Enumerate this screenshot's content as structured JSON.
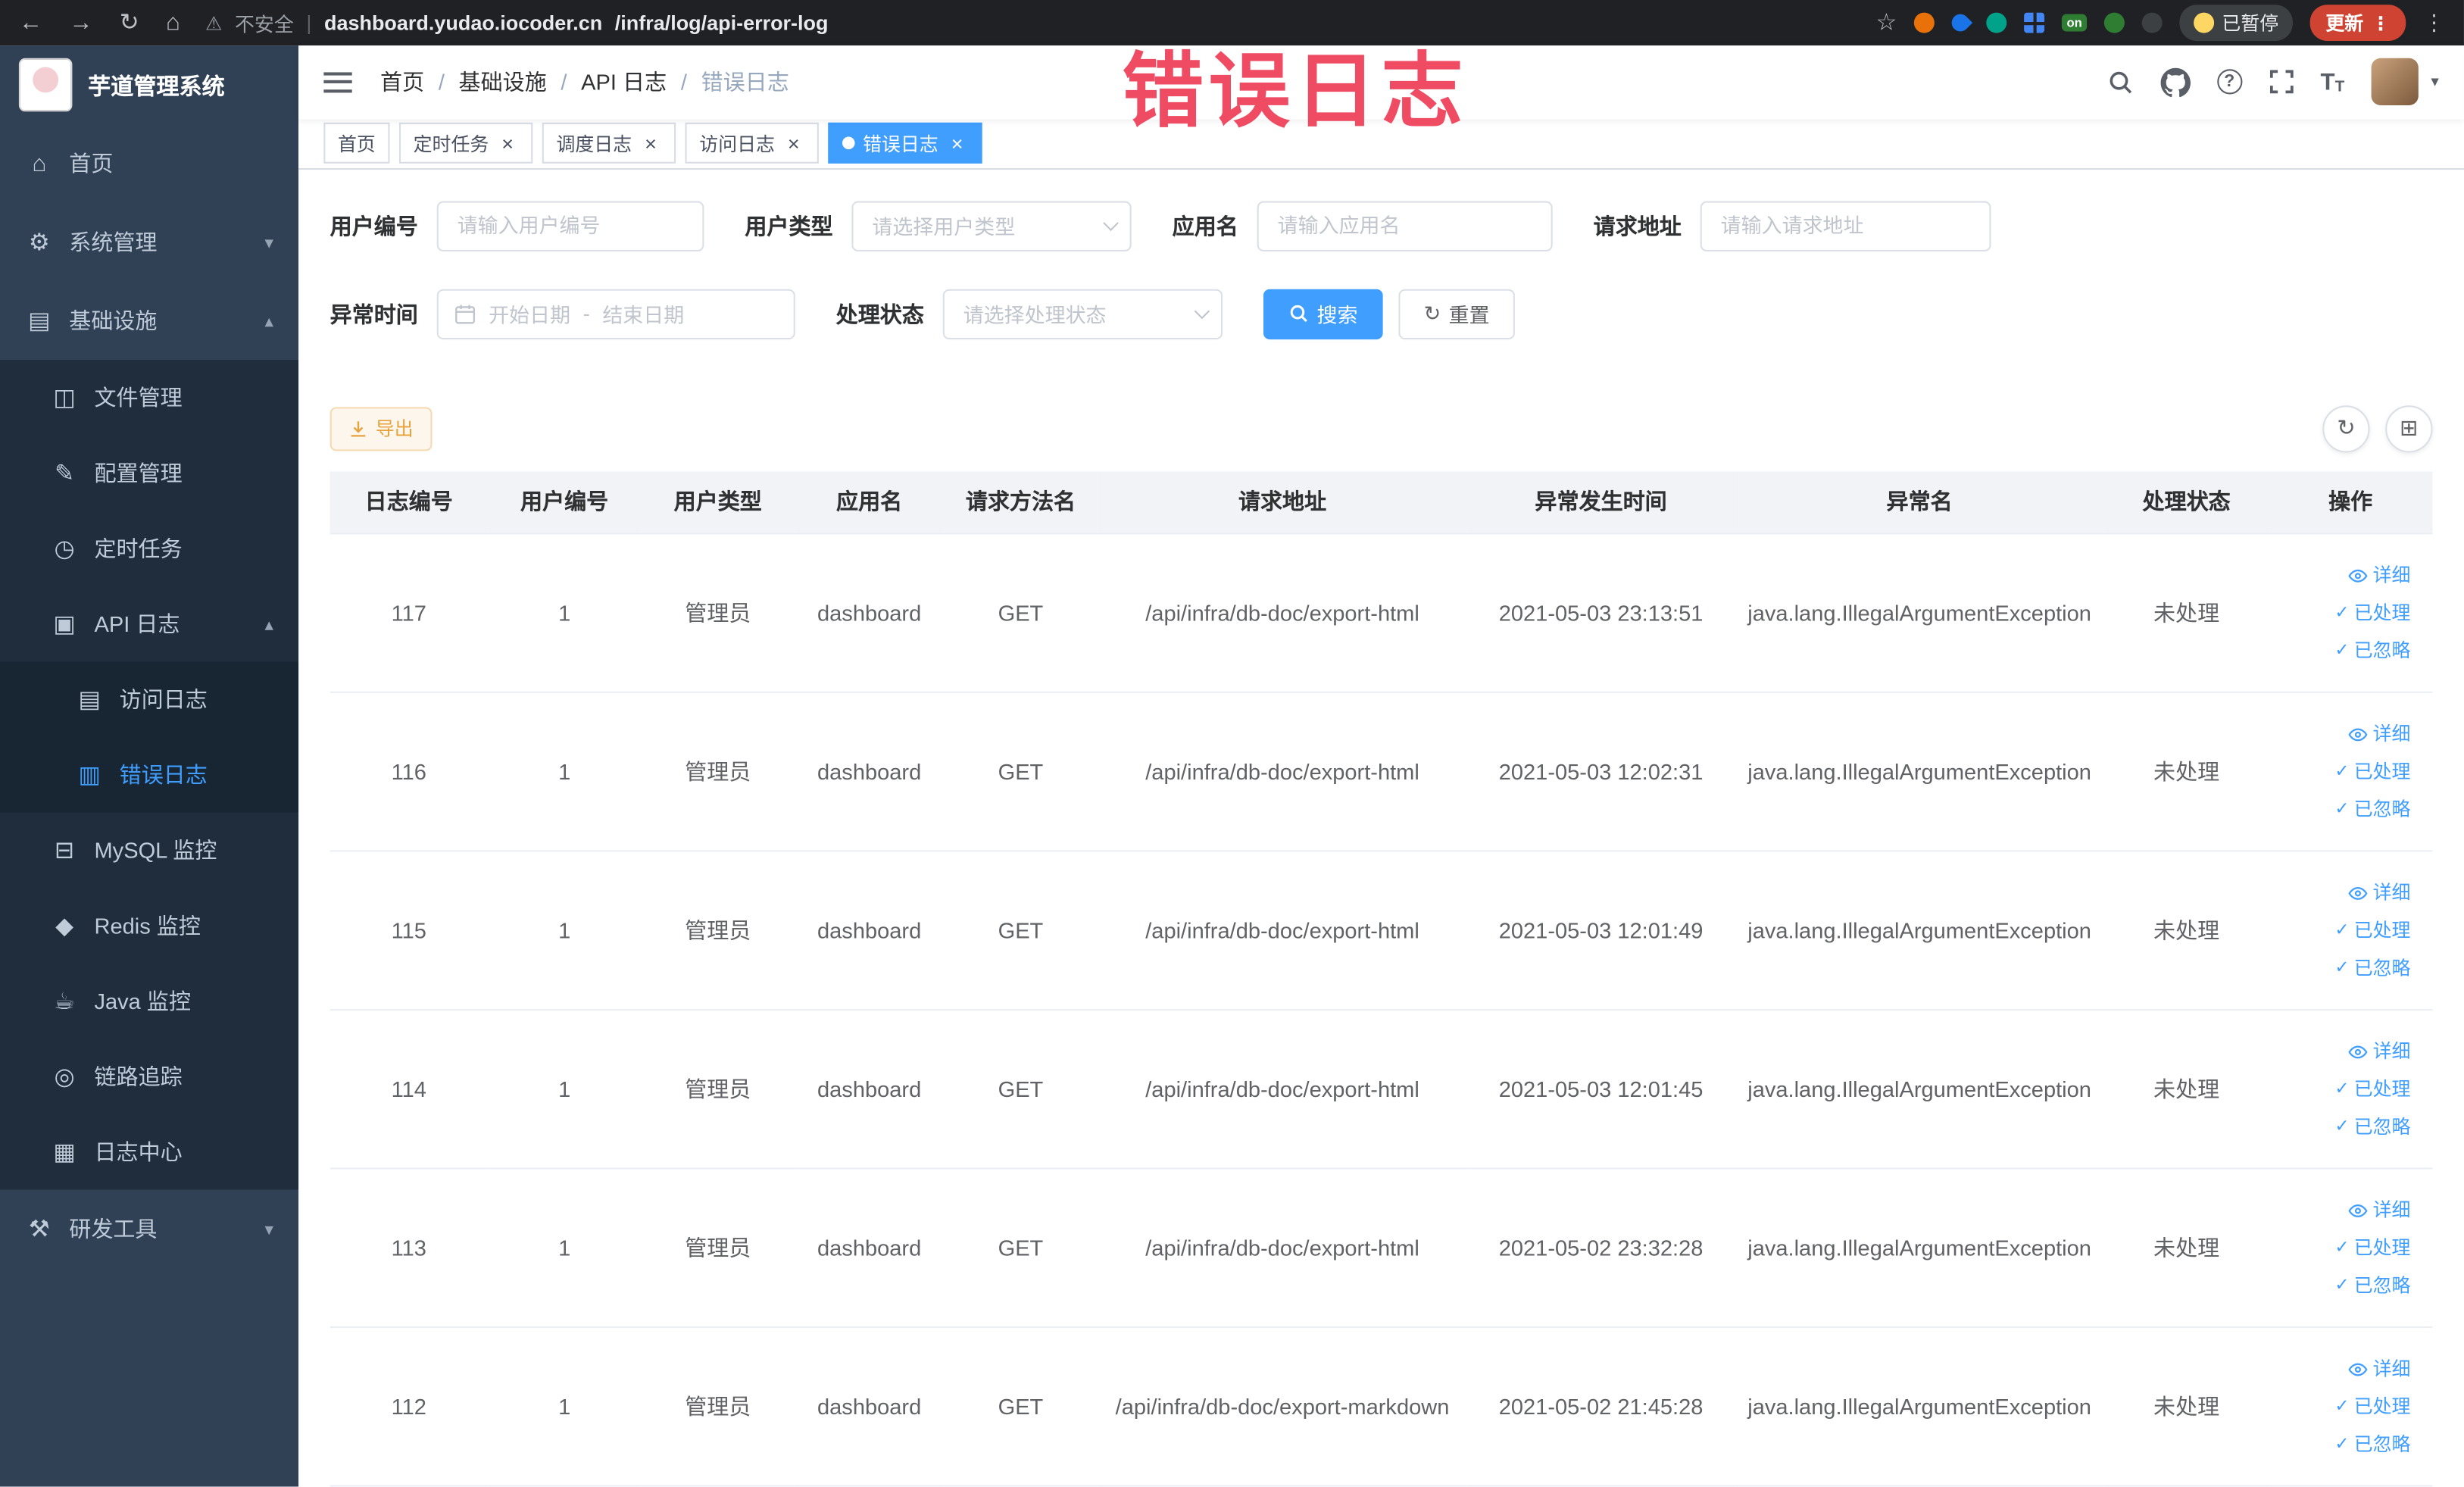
{
  "browser": {
    "security_label": "不安全",
    "url_domain": "dashboard.yudao.iocoder.cn",
    "url_path": "/infra/log/api-error-log",
    "paused_badge": "已暂停",
    "update_button": "更新"
  },
  "watermark": "错误日志",
  "icons": {
    "back": "←",
    "forward": "→",
    "reload": "↻",
    "home": "⌂",
    "warning": "⚠",
    "star": "☆",
    "more": "⋮",
    "close": "×",
    "caret": "▾",
    "chevron_down": "▾",
    "chevron_up": "▴",
    "refresh": "↻",
    "columns": "⊞",
    "check": "✓",
    "reset": "↻",
    "ext_on": "on",
    "font_large": "T",
    "font_small": "T"
  },
  "sidebar": {
    "title": "芋道管理系统",
    "items": [
      {
        "label": "首页",
        "glyph": "⌂"
      },
      {
        "label": "系统管理",
        "glyph": "⚙",
        "chevron": "▾"
      },
      {
        "label": "基础设施",
        "glyph": "▤",
        "chevron": "▴",
        "children": [
          {
            "label": "文件管理",
            "glyph": "◫"
          },
          {
            "label": "配置管理",
            "glyph": "✎"
          },
          {
            "label": "定时任务",
            "glyph": "◷"
          },
          {
            "label": "API 日志",
            "glyph": "▣",
            "chevron": "▴",
            "children": [
              {
                "label": "访问日志",
                "glyph": "▤"
              },
              {
                "label": "错误日志",
                "glyph": "▥",
                "active": true
              }
            ]
          },
          {
            "label": "MySQL 监控",
            "glyph": "⊟"
          },
          {
            "label": "Redis 监控",
            "glyph": "◆"
          },
          {
            "label": "Java 监控",
            "glyph": "☕"
          },
          {
            "label": "链路追踪",
            "glyph": "◎"
          },
          {
            "label": "日志中心",
            "glyph": "▦"
          }
        ]
      },
      {
        "label": "研发工具",
        "glyph": "⚒",
        "chevron": "▾"
      }
    ]
  },
  "breadcrumb": {
    "separator": "/",
    "items": [
      "首页",
      "基础设施",
      "API 日志",
      "错误日志"
    ]
  },
  "tabs": [
    {
      "label": "首页",
      "closable": false,
      "active": false
    },
    {
      "label": "定时任务",
      "closable": true,
      "active": false
    },
    {
      "label": "调度日志",
      "closable": true,
      "active": false
    },
    {
      "label": "访问日志",
      "closable": true,
      "active": false
    },
    {
      "label": "错误日志",
      "closable": true,
      "active": true
    }
  ],
  "filters": {
    "user_id": {
      "label": "用户编号",
      "placeholder": "请输入用户编号",
      "value": ""
    },
    "user_type": {
      "label": "用户类型",
      "placeholder": "请选择用户类型"
    },
    "app_name": {
      "label": "应用名",
      "placeholder": "请输入应用名",
      "value": ""
    },
    "request_url": {
      "label": "请求地址",
      "placeholder": "请输入请求地址",
      "value": ""
    },
    "exception_time": {
      "label": "异常时间",
      "start_placeholder": "开始日期",
      "separator": "-",
      "end_placeholder": "结束日期"
    },
    "process_status": {
      "label": "处理状态",
      "placeholder": "请选择处理状态"
    },
    "search_button": "搜索",
    "reset_button": "重置"
  },
  "toolbar": {
    "export_button": "导出"
  },
  "table": {
    "headers": [
      "日志编号",
      "用户编号",
      "用户类型",
      "应用名",
      "请求方法名",
      "请求地址",
      "异常发生时间",
      "异常名",
      "处理状态",
      "操作"
    ],
    "actions": [
      "详细",
      "已处理",
      "已忽略"
    ],
    "rows": [
      {
        "id": "117",
        "user_id": "1",
        "user_type": "管理员",
        "app": "dashboard",
        "method": "GET",
        "url": "/api/infra/db-doc/export-html",
        "time": "2021-05-03 23:13:51",
        "exception": "java.lang.IllegalArgumentException",
        "status": "未处理"
      },
      {
        "id": "116",
        "user_id": "1",
        "user_type": "管理员",
        "app": "dashboard",
        "method": "GET",
        "url": "/api/infra/db-doc/export-html",
        "time": "2021-05-03 12:02:31",
        "exception": "java.lang.IllegalArgumentException",
        "status": "未处理"
      },
      {
        "id": "115",
        "user_id": "1",
        "user_type": "管理员",
        "app": "dashboard",
        "method": "GET",
        "url": "/api/infra/db-doc/export-html",
        "time": "2021-05-03 12:01:49",
        "exception": "java.lang.IllegalArgumentException",
        "status": "未处理"
      },
      {
        "id": "114",
        "user_id": "1",
        "user_type": "管理员",
        "app": "dashboard",
        "method": "GET",
        "url": "/api/infra/db-doc/export-html",
        "time": "2021-05-03 12:01:45",
        "exception": "java.lang.IllegalArgumentException",
        "status": "未处理"
      },
      {
        "id": "113",
        "user_id": "1",
        "user_type": "管理员",
        "app": "dashboard",
        "method": "GET",
        "url": "/api/infra/db-doc/export-html",
        "time": "2021-05-02 23:32:28",
        "exception": "java.lang.IllegalArgumentException",
        "status": "未处理"
      },
      {
        "id": "112",
        "user_id": "1",
        "user_type": "管理员",
        "app": "dashboard",
        "method": "GET",
        "url": "/api/infra/db-doc/export-markdown",
        "time": "2021-05-02 21:45:28",
        "exception": "java.lang.IllegalArgumentException",
        "status": "未处理"
      }
    ]
  }
}
